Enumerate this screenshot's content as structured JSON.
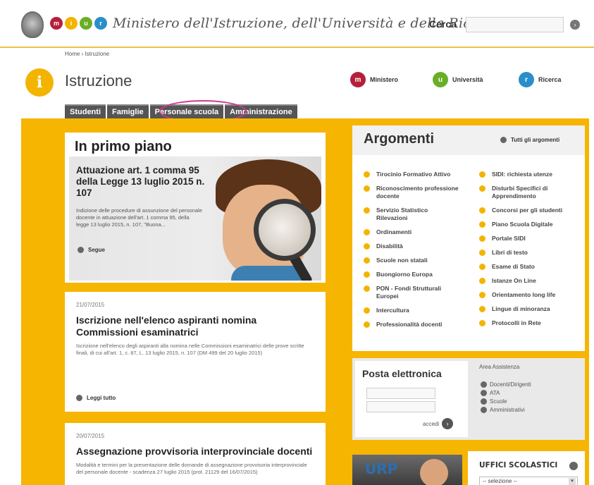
{
  "header": {
    "logo_letters": [
      "m",
      "i",
      "u",
      "r"
    ],
    "logo_colors": [
      "#b51f3a",
      "#f3b400",
      "#6aae27",
      "#2a8fc9"
    ],
    "ministry_title": "Ministero dell'Istruzione, dell'Università e della Ricerca",
    "search_label": "Cerca",
    "search_value": ""
  },
  "breadcrumb": "Home › Istruzione",
  "section": {
    "badge_letter": "i",
    "title": "Istruzione"
  },
  "brand_links": [
    {
      "letter": "m",
      "label": "Ministero",
      "color": "#b51f3a"
    },
    {
      "letter": "u",
      "label": "Università",
      "color": "#6aae27"
    },
    {
      "letter": "r",
      "label": "Ricerca",
      "color": "#2a8fc9"
    }
  ],
  "tabs": [
    "Studenti",
    "Famiglie",
    "Personale scuola",
    "Amministrazione"
  ],
  "primo_piano": {
    "title": "In primo piano",
    "headline": "Attuazione art. 1 comma 95 della Legge 13 luglio 2015 n. 107",
    "text": "Indizione delle procedure di assunzione del personale docente in attuazione dell'art. 1 comma 95, della legge 13 luglio 2015, n. 107, \"Buona...",
    "more_label": "Segue"
  },
  "news": [
    {
      "date": "21/07/2015",
      "title": "Iscrizione nell'elenco aspiranti nomina Commissioni esaminatrici",
      "text": "Iscrizione nell'elenco degli aspiranti alla nomina nelle Commissioni esaminatrici delle prove scritte finali, di cui all'art. 1, c. 87, L. 13 luglio 2015, n. 107 (DM 499 del 20 luglio 2015)",
      "more_label": "Leggi tutto"
    },
    {
      "date": "20/07/2015",
      "title": "Assegnazione provvisoria interprovinciale docenti",
      "text": "Modalità e termini per la presentazione delle domande di assegnazione provvisoria interprovinciale del personale docente - scadenza 27 luglio 2015 (prot. 21129 del 16/07/2015)"
    }
  ],
  "argomenti": {
    "title": "Argomenti",
    "all_label": "Tutti gli argomenti",
    "left": [
      "Tirocinio Formativo Attivo",
      "Riconoscimento professione docente",
      "Servizio Statistico Rilevazioni",
      "Ordinamenti",
      "Disabilità",
      "Scuole non statali",
      "Buongiorno Europa",
      "PON - Fondi Strutturali Europei",
      "Intercultura",
      "Professionalità docenti"
    ],
    "right": [
      "SIDI: richiesta utenze",
      "Disturbi Specifici di Apprendimento",
      "Concorsi per gli studenti",
      "Piano Scuola Digitale",
      "Portale SIDI",
      "Libri di testo",
      "Esame di Stato",
      "Istanze On Line",
      "Orientamento long life",
      "Lingue di minoranza",
      "Protocolli in Rete"
    ]
  },
  "posta": {
    "title": "Posta elettronica",
    "field1_value": "",
    "field2_value": "",
    "go_label": "accedi",
    "assist_title": "Area Assistenza",
    "assist_items": [
      "Docenti/Dirigenti",
      "ATA",
      "Scuole",
      "Amministrativi"
    ]
  },
  "urp": {
    "label": "URP"
  },
  "uffici": {
    "title": "UFFICI SCOLASTICI",
    "select_value": "-- selezione --"
  }
}
